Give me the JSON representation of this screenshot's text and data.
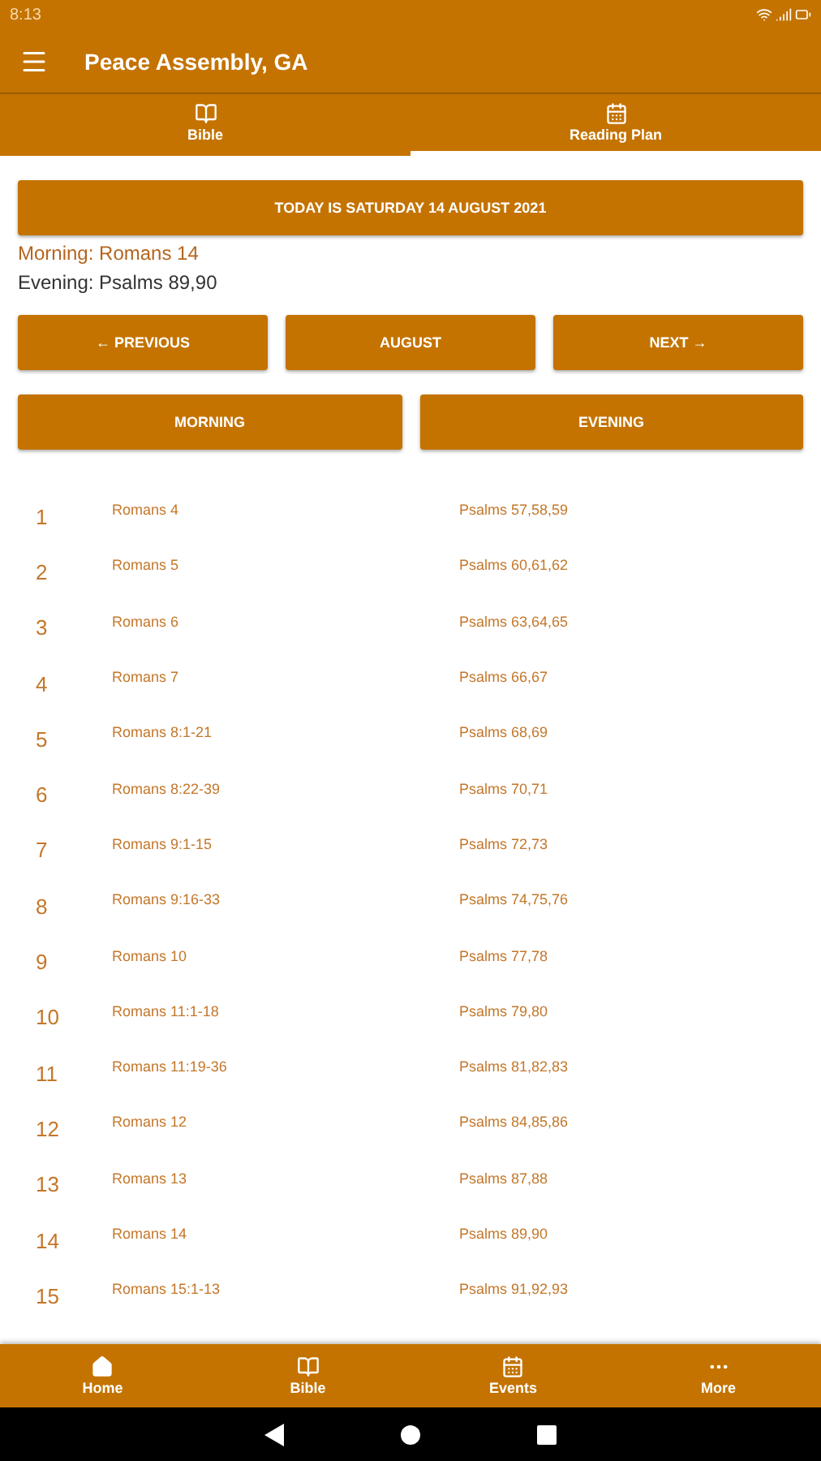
{
  "status_bar": {
    "time": "8:13"
  },
  "app_bar": {
    "title": "Peace Assembly, GA"
  },
  "tabs": [
    {
      "label": "Bible",
      "kind": "book",
      "selected": false
    },
    {
      "label": "Reading Plan",
      "kind": "calendar",
      "selected": true
    }
  ],
  "today_button": "TODAY IS SATURDAY 14 AUGUST 2021",
  "today_readings": [
    {
      "kind": "morning",
      "text": "Morning: Romans 14"
    },
    {
      "kind": "evening",
      "text": "Evening: Psalms 89,90"
    }
  ],
  "nav_buttons": [
    "← PREVIOUS",
    "AUGUST",
    "NEXT →"
  ],
  "session_buttons": [
    "MORNING",
    "EVENING"
  ],
  "plan_rows": [
    {
      "day": "1",
      "morning": "Romans 4",
      "evening": "Psalms 57,58,59"
    },
    {
      "day": "2",
      "morning": "Romans 5",
      "evening": "Psalms 60,61,62"
    },
    {
      "day": "3",
      "morning": "Romans 6",
      "evening": "Psalms 63,64,65"
    },
    {
      "day": "4",
      "morning": "Romans 7",
      "evening": "Psalms 66,67"
    },
    {
      "day": "5",
      "morning": "Romans 8:1-21",
      "evening": "Psalms 68,69"
    },
    {
      "day": "6",
      "morning": "Romans 8:22-39",
      "evening": "Psalms 70,71"
    },
    {
      "day": "7",
      "morning": "Romans 9:1-15",
      "evening": "Psalms 72,73"
    },
    {
      "day": "8",
      "morning": "Romans 9:16-33",
      "evening": "Psalms 74,75,76"
    },
    {
      "day": "9",
      "morning": "Romans 10",
      "evening": "Psalms 77,78"
    },
    {
      "day": "10",
      "morning": "Romans 11:1-18",
      "evening": "Psalms 79,80"
    },
    {
      "day": "11",
      "morning": "Romans 11:19-36",
      "evening": "Psalms 81,82,83"
    },
    {
      "day": "12",
      "morning": "Romans 12",
      "evening": "Psalms 84,85,86"
    },
    {
      "day": "13",
      "morning": "Romans 13",
      "evening": "Psalms 87,88"
    },
    {
      "day": "14",
      "morning": "Romans 14",
      "evening": "Psalms 89,90"
    },
    {
      "day": "15",
      "morning": "Romans 15:1-13",
      "evening": "Psalms 91,92,93"
    }
  ],
  "bottom_nav": [
    {
      "label": "Home",
      "kind": "home"
    },
    {
      "label": "Bible",
      "kind": "book"
    },
    {
      "label": "Events",
      "kind": "calendar"
    },
    {
      "label": "More",
      "kind": "more"
    }
  ]
}
